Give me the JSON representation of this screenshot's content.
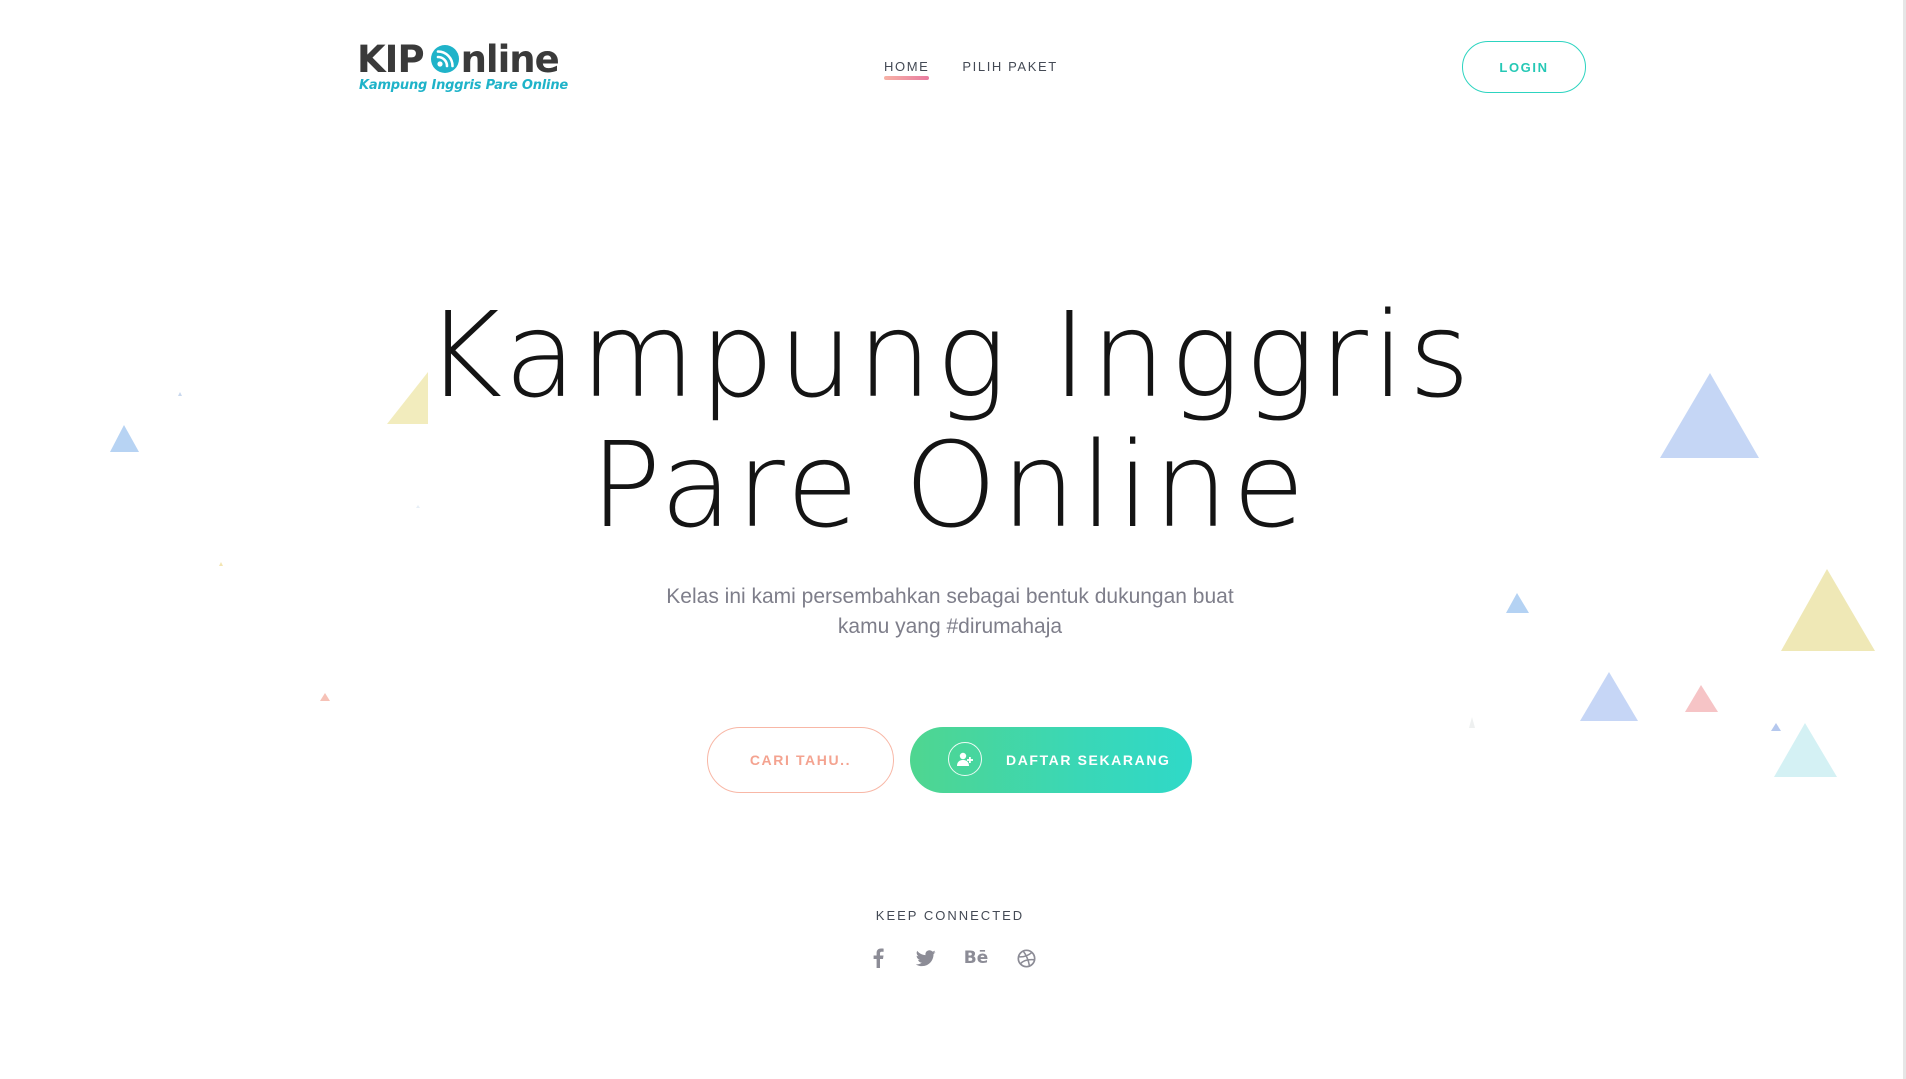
{
  "header": {
    "logo": {
      "main_text": "KIP Online",
      "text_before_icon": "KIP",
      "text_after_icon": "nline",
      "tagline": "Kampung Inggris Pare Online"
    },
    "nav": [
      {
        "label": "HOME",
        "active": true
      },
      {
        "label": "PILIH PAKET",
        "active": false
      }
    ],
    "login_label": "LOGIN"
  },
  "hero": {
    "title_line1": "Kampung Inggris",
    "title_line2": "Pare Online",
    "subtitle_line1": "Kelas ini kami persembahkan sebagai bentuk dukungan buat",
    "subtitle_line2": "kamu yang #dirumahaja",
    "primary_button": "DAFTAR SEKARANG",
    "secondary_button": "CARI TAHU.."
  },
  "footer": {
    "keep_connected": "KEEP CONNECTED",
    "social": [
      {
        "icon": "facebook-icon"
      },
      {
        "icon": "twitter-icon"
      },
      {
        "icon": "behance-icon",
        "glyph": "Bē"
      },
      {
        "icon": "dribbble-icon"
      }
    ]
  },
  "colors": {
    "accent_teal": "#2dd4c0",
    "accent_green": "#4fd690",
    "accent_coral": "#f4a390",
    "logo_teal": "#1fb3c9",
    "text_dark": "#141414",
    "text_muted": "#7e7e8a"
  }
}
